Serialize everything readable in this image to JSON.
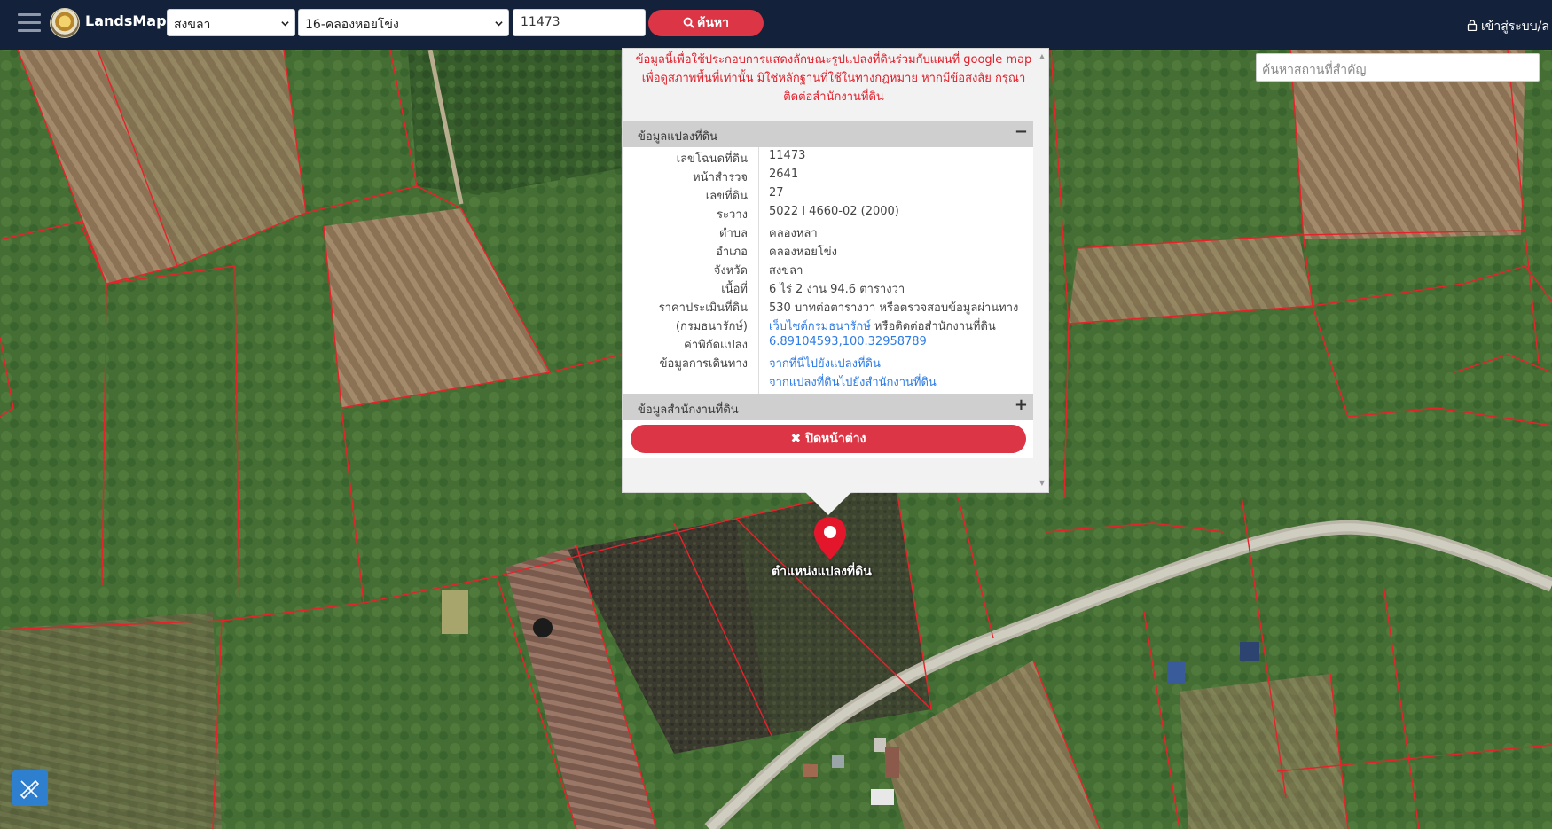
{
  "navbar": {
    "brand": "LandsMaps",
    "province": "สงขลา",
    "district": "16-คลองหอยโข่ง",
    "deed_number": "11473",
    "search_label": "ค้นหา",
    "login_label": "เข้าสู่ระบบ/ล"
  },
  "place_search": {
    "placeholder": "ค้นหาสถานที่สำคัญ"
  },
  "popup": {
    "disclaimer_line1": "ข้อมูลนี้เพื่อใช้ประกอบการแสดงลักษณะรูปแปลงที่ดินร่วมกับแผนที่ google map",
    "disclaimer_line2": "เพื่อดูสภาพพื้นที่เท่านั้น มิใช่หลักฐานที่ใช้ในทางกฎหมาย หากมีข้อสงสัย กรุณา",
    "disclaimer_line3": "ติดต่อสำนักงานที่ดิน",
    "land_section_title": "ข้อมูลแปลงที่ดิน",
    "office_section_title": "ข้อมูลสำนักงานที่ดิน",
    "collapse_symbol": "−",
    "expand_symbol": "+",
    "rows": {
      "deed_no": {
        "label": "เลขโฉนดที่ดิน",
        "value": "11473"
      },
      "survey_page": {
        "label": "หน้าสำรวจ",
        "value": "2641"
      },
      "land_no": {
        "label": "เลขที่ดิน",
        "value": "27"
      },
      "sheet": {
        "label": "ระวาง",
        "value": "5022 I 4660-02 (2000)"
      },
      "subdistrict": {
        "label": "ตำบล",
        "value": "คลองหลา"
      },
      "district": {
        "label": "อำเภอ",
        "value": "คลองหอยโข่ง"
      },
      "province": {
        "label": "จังหวัด",
        "value": "สงขลา"
      },
      "area": {
        "label": "เนื้อที่",
        "value": "6 ไร่ 2 งาน 94.6 ตารางวา"
      },
      "price": {
        "label": "ราคาประเมินที่ดิน",
        "value": "530 บาทต่อตารางวา หรือตรวจสอบข้อมูลผ่านทาง"
      },
      "price2": {
        "label": "(กรมธนารักษ์)",
        "link": "เว็บไซต์กรมธนารักษ์",
        "value": " หรือติดต่อสำนักงานที่ดิน"
      },
      "coords": {
        "label": "ค่าพิกัดแปลง",
        "value": "6.89104593,100.32958789"
      },
      "travel": {
        "label": "ข้อมูลการเดินทาง",
        "value": "จากที่นี่ไปยังแปลงที่ดิน"
      },
      "travel2": {
        "value": "จากแปลงที่ดินไปยังสำนักงานที่ดิน"
      }
    },
    "close_label": "ปิดหน้าต่าง"
  },
  "marker": {
    "label": "ตำแหน่งแปลงที่ดิน"
  },
  "colors": {
    "navbar": "#13223a",
    "accent_red": "#dc3545",
    "parcel_line": "#e8222b",
    "link_blue": "#2c7be5",
    "tool_blue": "#2f7fcf"
  }
}
